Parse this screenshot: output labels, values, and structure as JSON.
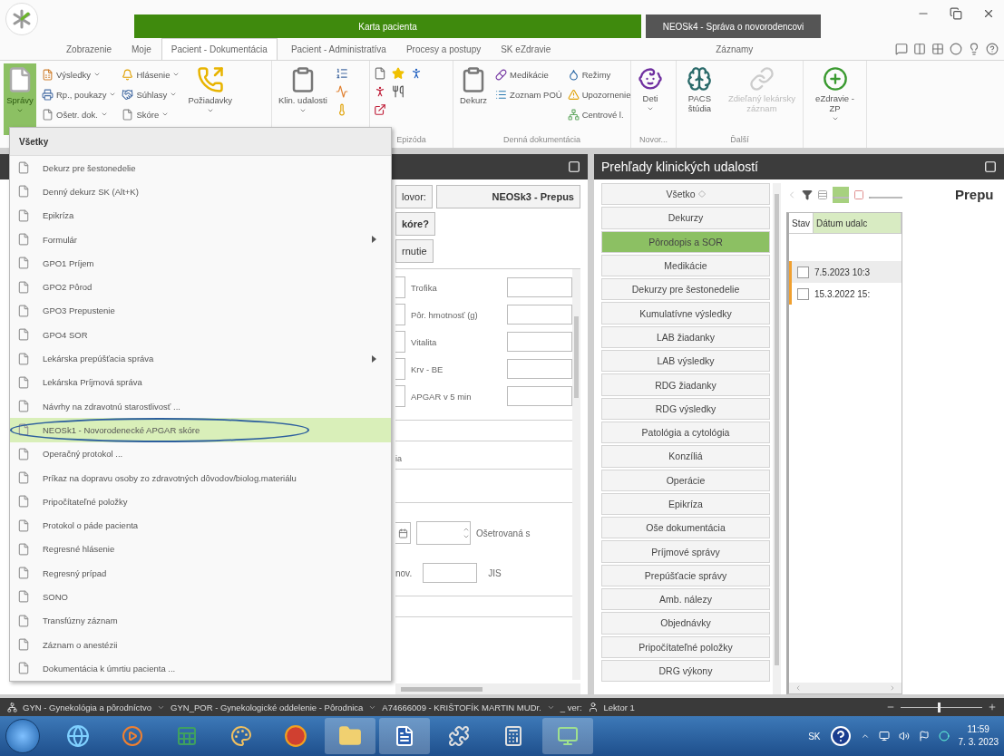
{
  "app": {
    "context_title": "Karta pacienta",
    "document_title": "NEOSk4 - Správa o novorodencovi"
  },
  "tabs": [
    {
      "label": "Zobrazenie",
      "selected": false
    },
    {
      "label": "Moje",
      "selected": false
    },
    {
      "label": "Pacient - Dokumentácia",
      "selected": true
    },
    {
      "label": "Pacient - Administratíva",
      "selected": false
    },
    {
      "label": "Procesy a postupy",
      "selected": false
    },
    {
      "label": "SK eZdravie",
      "selected": false
    },
    {
      "label": "Záznamy",
      "selected": false
    }
  ],
  "ribbon": {
    "groups": [
      {
        "items": [
          {
            "label": "Správy",
            "open": true,
            "dropdown": true
          },
          {
            "label": "Výsledky",
            "open": false,
            "dropdown": true
          },
          {
            "label": "Rp., poukazy",
            "open": false,
            "dropdown": true
          },
          {
            "label": "Ošetr. dok.",
            "open": false,
            "dropdown": true
          },
          {
            "label": "Hlásenie",
            "open": false,
            "dropdown": true
          },
          {
            "label": "Súhlasy",
            "open": false,
            "dropdown": true
          },
          {
            "label": "Skóre",
            "open": false,
            "dropdown": true
          },
          {
            "label": "Požiadavky",
            "open": false,
            "dropdown": true
          }
        ]
      },
      {
        "items": [
          {
            "label": "Klin. udalosti",
            "dropdown": true
          }
        ]
      },
      {
        "label": "Epizóda"
      },
      {
        "label": "Denná dokumentácia",
        "items": [
          {
            "label": "Dekurz",
            "dropdown": false
          },
          {
            "label": "Medikácie",
            "dropdown": false
          },
          {
            "label": "Zoznam POÚ",
            "dropdown": false
          },
          {
            "label": "Režimy",
            "dropdown": false
          },
          {
            "label": "Upozornenie",
            "dropdown": false
          },
          {
            "label": "Centrové l.",
            "dropdown": false
          }
        ]
      },
      {
        "label": "Novor...",
        "items": [
          {
            "label": "Deti",
            "dropdown": true
          }
        ]
      },
      {
        "label": "Ďalší",
        "items": [
          {
            "label": "PACS štúdia",
            "disabled": false
          },
          {
            "label": "Zdieľaný lekársky záznam",
            "disabled": true
          }
        ]
      },
      {
        "items": [
          {
            "label": "eZdravie - ZP",
            "dropdown": true
          }
        ]
      }
    ]
  },
  "menu": {
    "header": "Všetky",
    "items": [
      {
        "label": "Dekurz pre šestonedelie",
        "selected": false,
        "submenu": false,
        "circled": false
      },
      {
        "label": "Denný dekurz SK  (Alt+K)",
        "selected": false,
        "submenu": false,
        "circled": false
      },
      {
        "label": "Epikríza",
        "selected": false,
        "submenu": false,
        "circled": false
      },
      {
        "label": "Formulár",
        "selected": false,
        "submenu": true,
        "circled": false
      },
      {
        "label": "GPO1 Príjem",
        "selected": false,
        "submenu": false,
        "circled": false
      },
      {
        "label": "GPO2 Pôrod",
        "selected": false,
        "submenu": false,
        "circled": false
      },
      {
        "label": "GPO3 Prepustenie",
        "selected": false,
        "submenu": false,
        "circled": false
      },
      {
        "label": "GPO4 SOR",
        "selected": false,
        "submenu": false,
        "circled": false
      },
      {
        "label": "Lekárska prepúšťacia správa",
        "selected": false,
        "submenu": true,
        "circled": false
      },
      {
        "label": "Lekárska Príjmová správa",
        "selected": false,
        "submenu": false,
        "circled": false
      },
      {
        "label": "Návrhy na zdravotnú starostlivosť ...",
        "selected": false,
        "submenu": false,
        "circled": false
      },
      {
        "label": "NEOSk1 - Novorodenecké APGAR skóre",
        "selected": true,
        "submenu": false,
        "circled": true
      },
      {
        "label": "Operačný protokol ...",
        "selected": false,
        "submenu": false,
        "circled": false
      },
      {
        "label": "Príkaz na dopravu osoby zo zdravotných dôvodov/biolog.materiálu",
        "selected": false,
        "submenu": false,
        "circled": false
      },
      {
        "label": "Pripočítateľné položky",
        "selected": false,
        "submenu": false,
        "circled": false
      },
      {
        "label": "Protokol o páde pacienta",
        "selected": false,
        "submenu": false,
        "circled": false
      },
      {
        "label": "Regresné hlásenie",
        "selected": false,
        "submenu": false,
        "circled": false
      },
      {
        "label": "Regresný prípad",
        "selected": false,
        "submenu": false,
        "circled": false
      },
      {
        "label": "SONO",
        "selected": false,
        "submenu": false,
        "circled": false
      },
      {
        "label": "Transfúzny záznam",
        "selected": false,
        "submenu": false,
        "circled": false
      },
      {
        "label": "Záznam o anestézii",
        "selected": false,
        "submenu": false,
        "circled": false
      },
      {
        "label": "Dokumentácia k úmrtiu pacienta ...",
        "selected": false,
        "submenu": false,
        "circled": false
      }
    ]
  },
  "form": {
    "buttons": [
      "lovor:",
      "NEOSk3 - Prepus",
      "kóre?",
      "rnutie"
    ],
    "fields": [
      {
        "label": "Trofika"
      },
      {
        "label": "Pôr. hmotnosť (g)"
      },
      {
        "label": "Vitalita"
      },
      {
        "label": "Krv - BE"
      },
      {
        "label": "APGAR v 5 min"
      }
    ],
    "fragment": "ia",
    "treated_label": "Ošetrovaná s",
    "nov_label": "nov.",
    "jis_label": "JIS"
  },
  "events_panel": {
    "title": "Prehľady klinických udalostí",
    "categories": [
      {
        "label": "Všetko",
        "selected": false
      },
      {
        "label": "Dekurzy",
        "selected": false
      },
      {
        "label": "Pôrodopis a SOR",
        "selected": true
      },
      {
        "label": "Medikácie",
        "selected": false
      },
      {
        "label": "Dekurzy pre šestonedelie",
        "selected": false
      },
      {
        "label": "Kumulatívne výsledky",
        "selected": false
      },
      {
        "label": "LAB žiadanky",
        "selected": false
      },
      {
        "label": "LAB výsledky",
        "selected": false
      },
      {
        "label": "RDG žiadanky",
        "selected": false
      },
      {
        "label": "RDG výsledky",
        "selected": false
      },
      {
        "label": "Patológia a cytológia",
        "selected": false
      },
      {
        "label": "Konzíliá",
        "selected": false
      },
      {
        "label": "Operácie",
        "selected": false
      },
      {
        "label": "Epikríza",
        "selected": false
      },
      {
        "label": "Oše dokumentácia",
        "selected": false
      },
      {
        "label": "Príjmové správy",
        "selected": false
      },
      {
        "label": "Prepúšťacie správy",
        "selected": false
      },
      {
        "label": "Amb. nálezy",
        "selected": false
      },
      {
        "label": "Objednávky",
        "selected": false
      },
      {
        "label": "Pripočítateľné položky",
        "selected": false
      },
      {
        "label": "DRG výkony",
        "selected": false
      }
    ],
    "columns": [
      {
        "label": "Stav",
        "sorted": false
      },
      {
        "label": "Dátum udalc",
        "sorted": true
      }
    ],
    "rows": [
      {
        "date": "7.5.2023 10:3",
        "checked": false,
        "selected": true
      },
      {
        "date": "15.3.2022 15:",
        "checked": false,
        "selected": false
      }
    ],
    "preview_title": "Prepu"
  },
  "status_bar": {
    "items": [
      "GYN - Gynekológia a pôrodníctvo",
      "GYN_POR - Gynekologické oddelenie - Pôrodnica",
      "A74666009 - KRIŠTOFÍK MARTIN MUDr."
    ],
    "version": "_ ver:",
    "user": "Lektor 1",
    "zoom": {
      "level": 0.45
    }
  },
  "taskbar": {
    "language": "SK",
    "time": "11:59",
    "date": "7. 3. 2023"
  }
}
